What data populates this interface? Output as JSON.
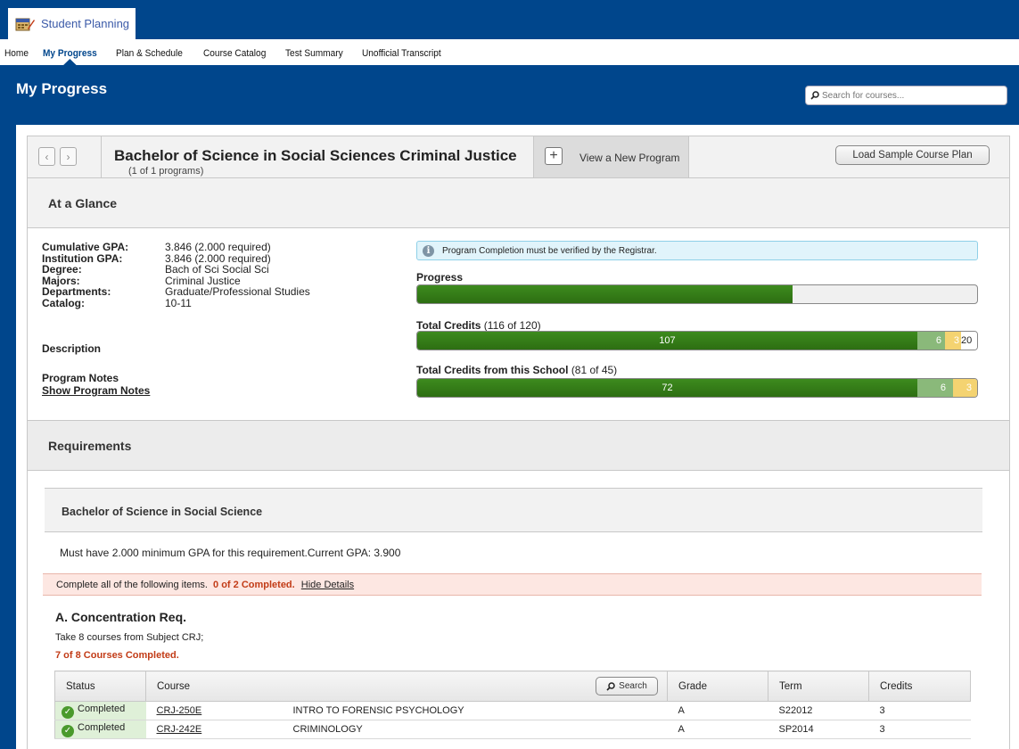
{
  "app": {
    "title": "Student Planning",
    "icon": "calendar-icon"
  },
  "nav": {
    "items": [
      {
        "label": "Home",
        "active": false
      },
      {
        "label": "My Progress",
        "active": true
      },
      {
        "label": "Plan & Schedule",
        "active": false
      },
      {
        "label": "Course Catalog",
        "active": false
      },
      {
        "label": "Test Summary",
        "active": false
      },
      {
        "label": "Unofficial Transcript",
        "active": false
      }
    ]
  },
  "page": {
    "title": "My Progress"
  },
  "search": {
    "placeholder": "Search for courses..."
  },
  "program": {
    "title": "Bachelor of Science in Social Sciences Criminal Justice",
    "count": "(1 of 1 programs)",
    "view_new_label": "View a New Program",
    "sample_label": "Load Sample Course Plan"
  },
  "glance": {
    "heading": "At a Glance",
    "facts": [
      {
        "key": "Cumulative GPA:",
        "value": "3.846 (2.000 required)"
      },
      {
        "key": "Institution GPA:",
        "value": "3.846 (2.000 required)"
      },
      {
        "key": "Degree:",
        "value": "Bach of Sci Social Sci"
      },
      {
        "key": "Majors:",
        "value": "Criminal Justice"
      },
      {
        "key": "Departments:",
        "value": "Graduate/Professional Studies"
      },
      {
        "key": "Catalog:",
        "value": "10-11"
      }
    ],
    "description_label": "Description",
    "notes_label": "Program Notes",
    "notes_link": "Show Program Notes",
    "info_message": "Program Completion must be verified by the Registrar.",
    "progress": {
      "label": "Progress",
      "fraction": 0.67
    },
    "total_credits": {
      "label": "Total Credits",
      "detail": "(116 of 120)",
      "completed": 107,
      "in_progress": 6,
      "planned": 3,
      "remaining": 20,
      "segments": [
        "107",
        "6",
        "3",
        "20"
      ]
    },
    "school_credits": {
      "label": "Total Credits from this School",
      "detail": "(81 of 45)",
      "completed": 72,
      "in_progress": 6,
      "planned": 3,
      "segments": [
        "72",
        "6",
        "3"
      ]
    }
  },
  "requirements": {
    "heading": "Requirements",
    "block_title": "Bachelor of Science in Social Science",
    "gpa_note": "Must have 2.000 minimum GPA for this requirement.Current GPA: 3.900",
    "status_text": "Complete all of the following items.",
    "status_count": "0 of 2 Completed.",
    "hide_details": "Hide Details",
    "group": {
      "title": "A. Concentration Req.",
      "instruction": "Take 8 courses from Subject CRJ;",
      "completed": "7 of 8 Courses Completed."
    },
    "table": {
      "headers": [
        "Status",
        "Course",
        "Grade",
        "Term",
        "Credits"
      ],
      "search_label": "Search",
      "rows": [
        {
          "status": "Completed",
          "code": "CRJ-250E",
          "name": "INTRO TO FORENSIC PSYCHOLOGY",
          "grade": "A",
          "term": "S22012",
          "credits": "3"
        },
        {
          "status": "Completed",
          "code": "CRJ-242E",
          "name": "CRIMINOLOGY",
          "grade": "A",
          "term": "SP2014",
          "credits": "3"
        }
      ]
    }
  },
  "colors": {
    "brand_blue": "#00468c",
    "progress_green": "#2d6e12",
    "alert_red": "#c23b16"
  }
}
